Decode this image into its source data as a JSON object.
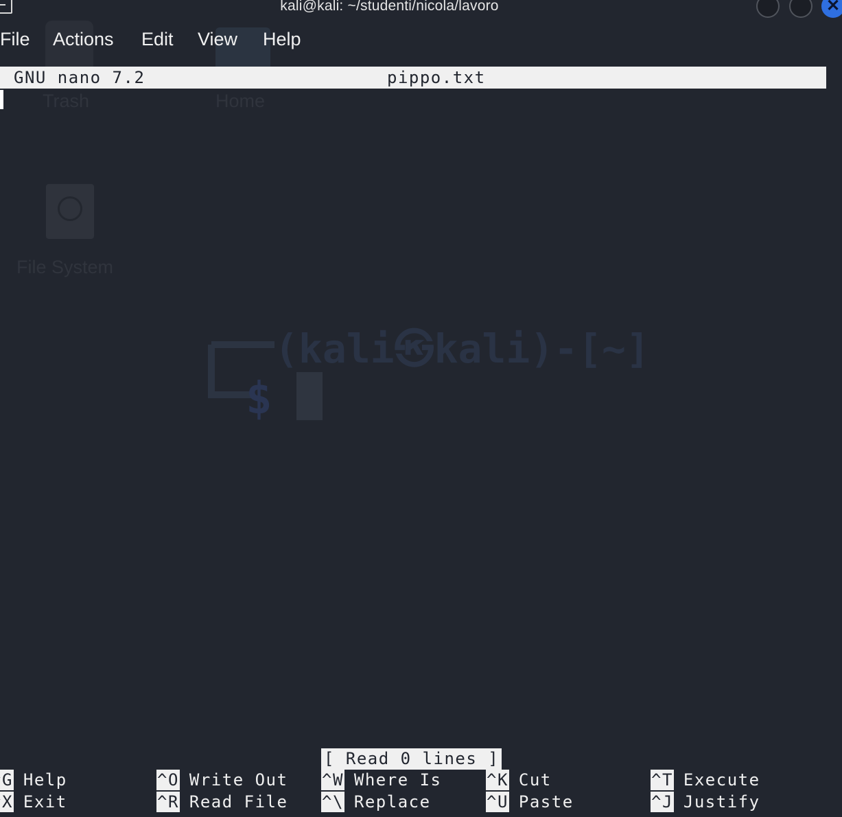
{
  "window": {
    "title": "kali@kali: ~/studenti/nicola/lavoro",
    "close_glyph": "✕"
  },
  "menu": [
    "File",
    "Actions",
    "Edit",
    "View",
    "Help"
  ],
  "desktop": {
    "icons": [
      "Trash",
      "Home",
      "File System"
    ],
    "wallpaper_text": "(kali㉿kali)-[~]",
    "prompt_symbol": "$"
  },
  "nano": {
    "version": "GNU nano 7.2",
    "filename": "pippo.txt",
    "status": "[ Read 0 lines ]",
    "shortcuts": [
      {
        "key": "^G",
        "label": "Help"
      },
      {
        "key": "^O",
        "label": "Write Out"
      },
      {
        "key": "^W",
        "label": "Where Is"
      },
      {
        "key": "^K",
        "label": "Cut"
      },
      {
        "key": "^T",
        "label": "Execute"
      },
      {
        "key": "^X",
        "label": "Exit"
      },
      {
        "key": "^R",
        "label": "Read File"
      },
      {
        "key": "^\\",
        "label": "Replace"
      },
      {
        "key": "^U",
        "label": "Paste"
      },
      {
        "key": "^J",
        "label": "Justify"
      }
    ]
  },
  "colors": {
    "background": "#22262f",
    "bar": "#f0f0f0",
    "text": "#f0f0f0",
    "close_button": "#2f6fe0"
  }
}
